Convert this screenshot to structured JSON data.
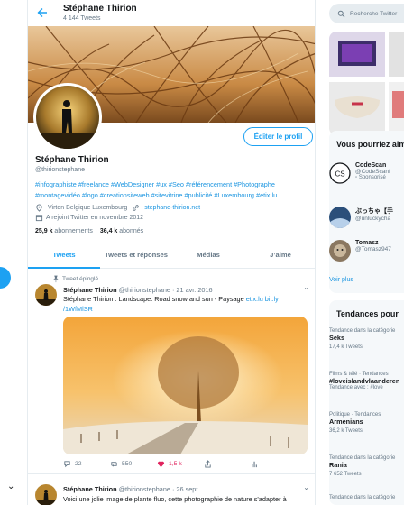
{
  "header": {
    "name": "Stéphane Thirion",
    "tweet_count": "4 144 Tweets"
  },
  "profile": {
    "edit_label": "Éditer le profil",
    "name": "Stéphane Thirion",
    "handle": "@thirionstephane",
    "bio": "#infographiste #freelance #WebDesigner #ux #Seo #référencement #Photographe #montagevidéo #logo #creationsiteweb #sitevitrine #publicité #Luxembourg #etix.lu",
    "location": "Virton Belgique   Luxembourg",
    "website": "stephane-thirion.net",
    "joined": "A rejoint Twitter en novembre 2012",
    "following_count": "25,9 k",
    "following_label": "abonnements",
    "followers_count": "36,4 k",
    "followers_label": "abonnés"
  },
  "tabs": [
    {
      "label": "Tweets"
    },
    {
      "label": "Tweets et réponses"
    },
    {
      "label": "Médias"
    },
    {
      "label": "J’aime"
    }
  ],
  "tweet1": {
    "pinned_label": "Tweet épinglé",
    "name": "Stéphane Thirion",
    "handle": "@thirionstephane",
    "date": "· 21 avr. 2016",
    "text": "Stéphane Thirion : Landscape: Road snow and sun - Paysage ",
    "link1": "etix.lu",
    "link2": "bit.ly",
    "link3": "/1WfMlSR",
    "replies": "22",
    "retweets": "550",
    "likes": "1,5 k"
  },
  "tweet2": {
    "name": "Stéphane Thirion",
    "handle": "@thirionstephane",
    "date": "· 26 sept.",
    "text": "Voici une jolie image de plante fluo, cette photographie de nature s'adapter à"
  },
  "right": {
    "search_placeholder": "Recherche Twitter",
    "who_title": "Vous pourriez aimer",
    "suggestions": [
      {
        "name": "CodeScan",
        "handle": "@CodeScanf",
        "sponsored": "Sponsorisé"
      },
      {
        "name": "ぶっちゃ【手",
        "handle": "@unluckycha"
      },
      {
        "name": "Tomasz",
        "handle": "@Tomasz947"
      }
    ],
    "voir_plus": "Voir plus",
    "trends_title": "Tendances pour",
    "trends": [
      {
        "context": "Tendance dans la catégorie",
        "name": "Seks",
        "count": "17,4 k Tweets"
      },
      {
        "context": "Films & télé · Tendances",
        "name": "#loveislandvlaanderen",
        "count": "Tendance avec : #love"
      },
      {
        "context": "Politique · Tendances",
        "name": "Armenians",
        "count": "36,2 k Tweets"
      },
      {
        "context": "Tendance dans la catégorie",
        "name": "Rania",
        "count": "7 652 Tweets"
      },
      {
        "context": "Tendance dans la catégorie",
        "name": "",
        "count": ""
      }
    ]
  },
  "colors": {
    "accent": "#1da1f2",
    "link": "#1b95e0",
    "like": "#e0245e",
    "muted": "#657786"
  }
}
